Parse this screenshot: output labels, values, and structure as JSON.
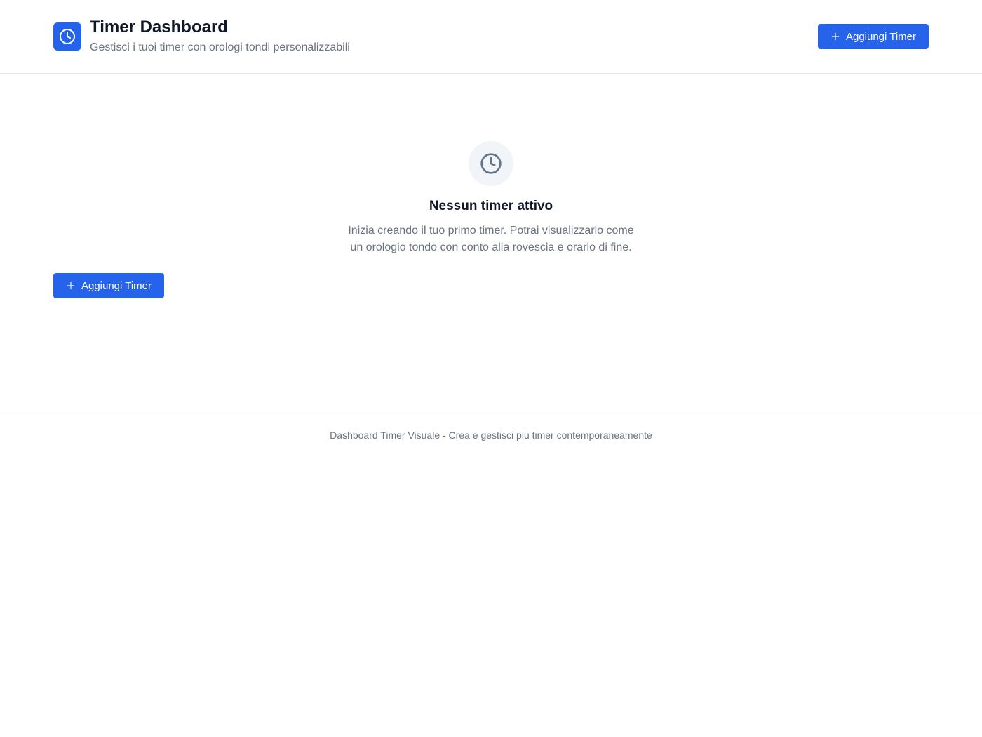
{
  "header": {
    "title": "Timer Dashboard",
    "subtitle": "Gestisci i tuoi timer con orologi tondi personalizzabili",
    "logo_icon": "clock-icon",
    "add_button_label": "Aggiungi Timer",
    "add_button_icon": "plus-icon"
  },
  "empty_state": {
    "icon": "clock-icon",
    "title": "Nessun timer attivo",
    "description_line1": "Inizia creando il tuo primo timer. Potrai visualizzarlo come",
    "description_line2": "un orologio tondo con conto alla rovescia e orario di fine.",
    "add_button_label": "Aggiungi Timer",
    "add_button_icon": "plus-icon"
  },
  "footer": {
    "text": "Dashboard Timer Visuale - Crea e gestisci più timer contemporaneamente"
  },
  "colors": {
    "accent": "#2563eb",
    "text_primary": "#111827",
    "text_secondary": "#6b7280",
    "border": "#e5e7eb",
    "icon_bg": "#f1f5f9",
    "icon_stroke": "#64748b"
  }
}
